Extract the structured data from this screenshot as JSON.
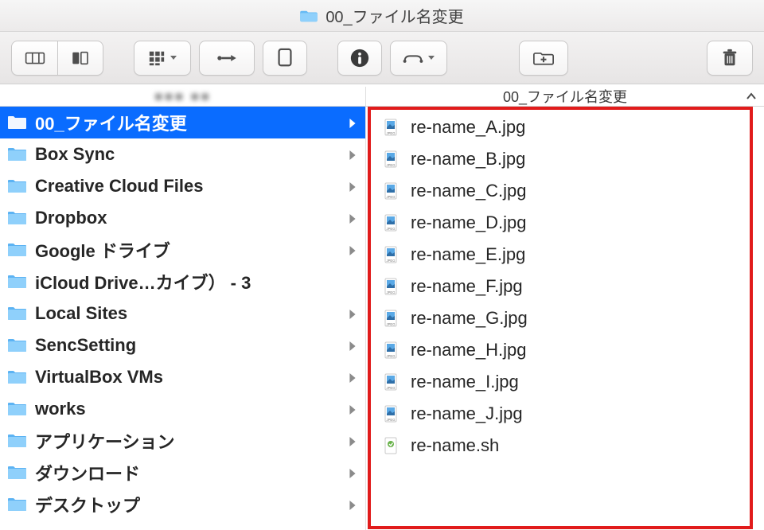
{
  "window": {
    "title": "00_ファイル名変更"
  },
  "toolbar": {
    "view_columns_icon": "columns-view-icon",
    "view_gallery_icon": "gallery-view-icon",
    "arrange_icon": "arrange-icon",
    "share_icon": "share-icon",
    "quicklook_icon": "quicklook-icon",
    "getinfo_icon": "info-icon",
    "path_icon": "path-icon",
    "newfolder_icon": "new-folder-icon",
    "trash_icon": "trash-icon"
  },
  "columns": {
    "left_header": "■■■  ■■",
    "right_header": "00_ファイル名変更"
  },
  "left_items": [
    {
      "name": "00_ファイル名変更",
      "has_children": true,
      "selected": true,
      "icon": "folder"
    },
    {
      "name": "Box Sync",
      "has_children": true,
      "icon": "folder"
    },
    {
      "name": "Creative Cloud Files",
      "has_children": true,
      "icon": "cc"
    },
    {
      "name": "Dropbox",
      "has_children": true,
      "icon": "dropbox"
    },
    {
      "name": "Google ドライブ",
      "has_children": true,
      "icon": "gdrive"
    },
    {
      "name": "iCloud Drive…カイブ） - 3",
      "has_children": false,
      "icon": "folder"
    },
    {
      "name": "Local Sites",
      "has_children": true,
      "icon": "folder"
    },
    {
      "name": "SencSetting",
      "has_children": true,
      "icon": "folder"
    },
    {
      "name": "VirtualBox VMs",
      "has_children": true,
      "icon": "folder"
    },
    {
      "name": "works",
      "has_children": true,
      "icon": "folder"
    },
    {
      "name": "アプリケーション",
      "has_children": true,
      "icon": "folder"
    },
    {
      "name": "ダウンロード",
      "has_children": true,
      "icon": "downloads"
    },
    {
      "name": "デスクトップ",
      "has_children": true,
      "icon": "desktop"
    }
  ],
  "right_items": [
    {
      "name": "re-name_A.jpg",
      "kind": "jpg"
    },
    {
      "name": "re-name_B.jpg",
      "kind": "jpg"
    },
    {
      "name": "re-name_C.jpg",
      "kind": "jpg"
    },
    {
      "name": "re-name_D.jpg",
      "kind": "jpg"
    },
    {
      "name": "re-name_E.jpg",
      "kind": "jpg"
    },
    {
      "name": "re-name_F.jpg",
      "kind": "jpg"
    },
    {
      "name": "re-name_G.jpg",
      "kind": "jpg"
    },
    {
      "name": "re-name_H.jpg",
      "kind": "jpg"
    },
    {
      "name": "re-name_I.jpg",
      "kind": "jpg"
    },
    {
      "name": "re-name_J.jpg",
      "kind": "jpg"
    },
    {
      "name": "re-name.sh",
      "kind": "sh"
    }
  ]
}
